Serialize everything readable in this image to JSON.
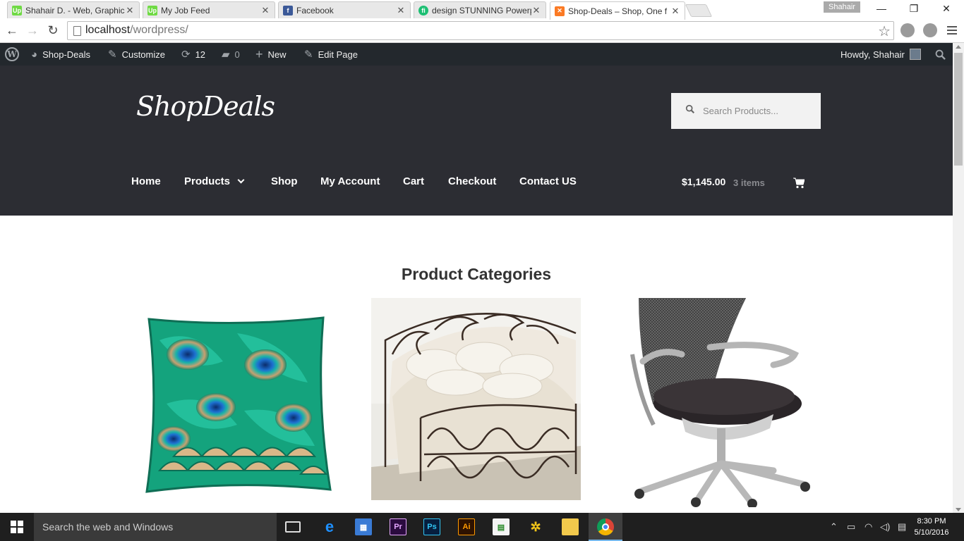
{
  "browser": {
    "tabs": [
      {
        "title": "Shahair D. - Web, Graphic",
        "favicon": "upwork-icon"
      },
      {
        "title": "My Job Feed",
        "favicon": "upwork-icon"
      },
      {
        "title": "Facebook",
        "favicon": "facebook-icon"
      },
      {
        "title": "design STUNNING Powerp",
        "favicon": "fiverr-icon"
      },
      {
        "title": "Shop-Deals – Shop, One f",
        "favicon": "xampp-icon",
        "active": true
      }
    ],
    "profile_name": "Shahair",
    "url_host": "localhost",
    "url_path": "/wordpress/"
  },
  "admin_bar": {
    "site_name": "Shop-Deals",
    "customize": "Customize",
    "updates_count": "12",
    "comments_count": "0",
    "new_label": "New",
    "edit_page": "Edit Page",
    "howdy": "Howdy, Shahair"
  },
  "site": {
    "logo_text": "ShopDeals",
    "search_placeholder": "Search Products...",
    "nav": [
      "Home",
      "Products",
      "Shop",
      "My Account",
      "Cart",
      "Checkout",
      "Contact US"
    ],
    "cart_total": "$1,145.00",
    "cart_items": "3 items"
  },
  "content": {
    "section_title": "Product Categories",
    "categories": [
      {
        "image": "peacock-feather-pillow"
      },
      {
        "image": "wrought-iron-bed"
      },
      {
        "image": "mesh-office-chair"
      }
    ]
  },
  "taskbar": {
    "search_placeholder": "Search the web and Windows",
    "time": "8:30 PM",
    "date": "5/10/2016"
  },
  "colors": {
    "admin_bar": "#23282d",
    "header_bg": "#2c2d33",
    "taskbar": "#1f1f1f"
  }
}
